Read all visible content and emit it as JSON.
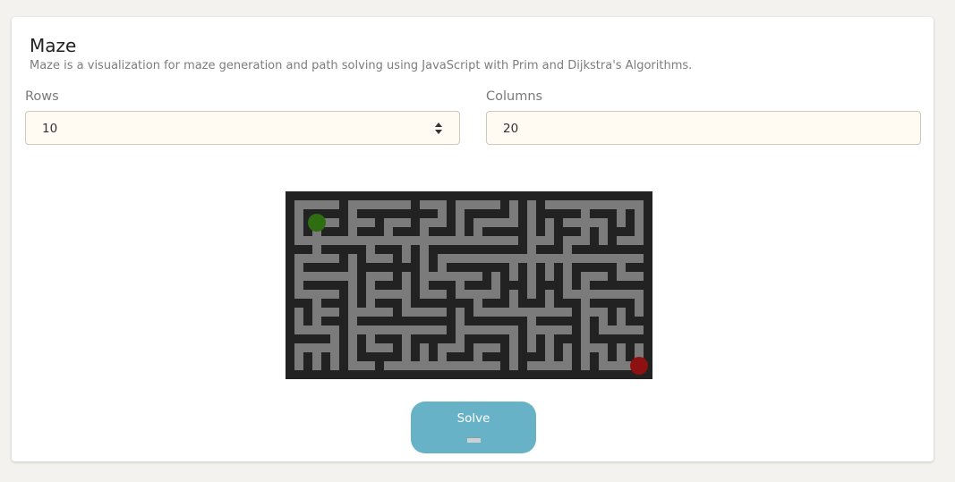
{
  "header": {
    "title": "Maze",
    "subtitle": "Maze is a visualization for maze generation and path solving using JavaScript with Prim and Dijkstra's Algorithms."
  },
  "form": {
    "rows": {
      "label": "Rows",
      "value": "10"
    },
    "columns": {
      "label": "Columns",
      "value": "20"
    }
  },
  "maze": {
    "rows": 10,
    "columns": 20,
    "colors": {
      "wall": "#222222",
      "path": "#7b7b7b",
      "start": "#2f6d12",
      "end": "#8e1111"
    },
    "start_cell": [
      1,
      1
    ],
    "end_cell": [
      19,
      19
    ]
  },
  "actions": {
    "solve_label": "Solve"
  }
}
